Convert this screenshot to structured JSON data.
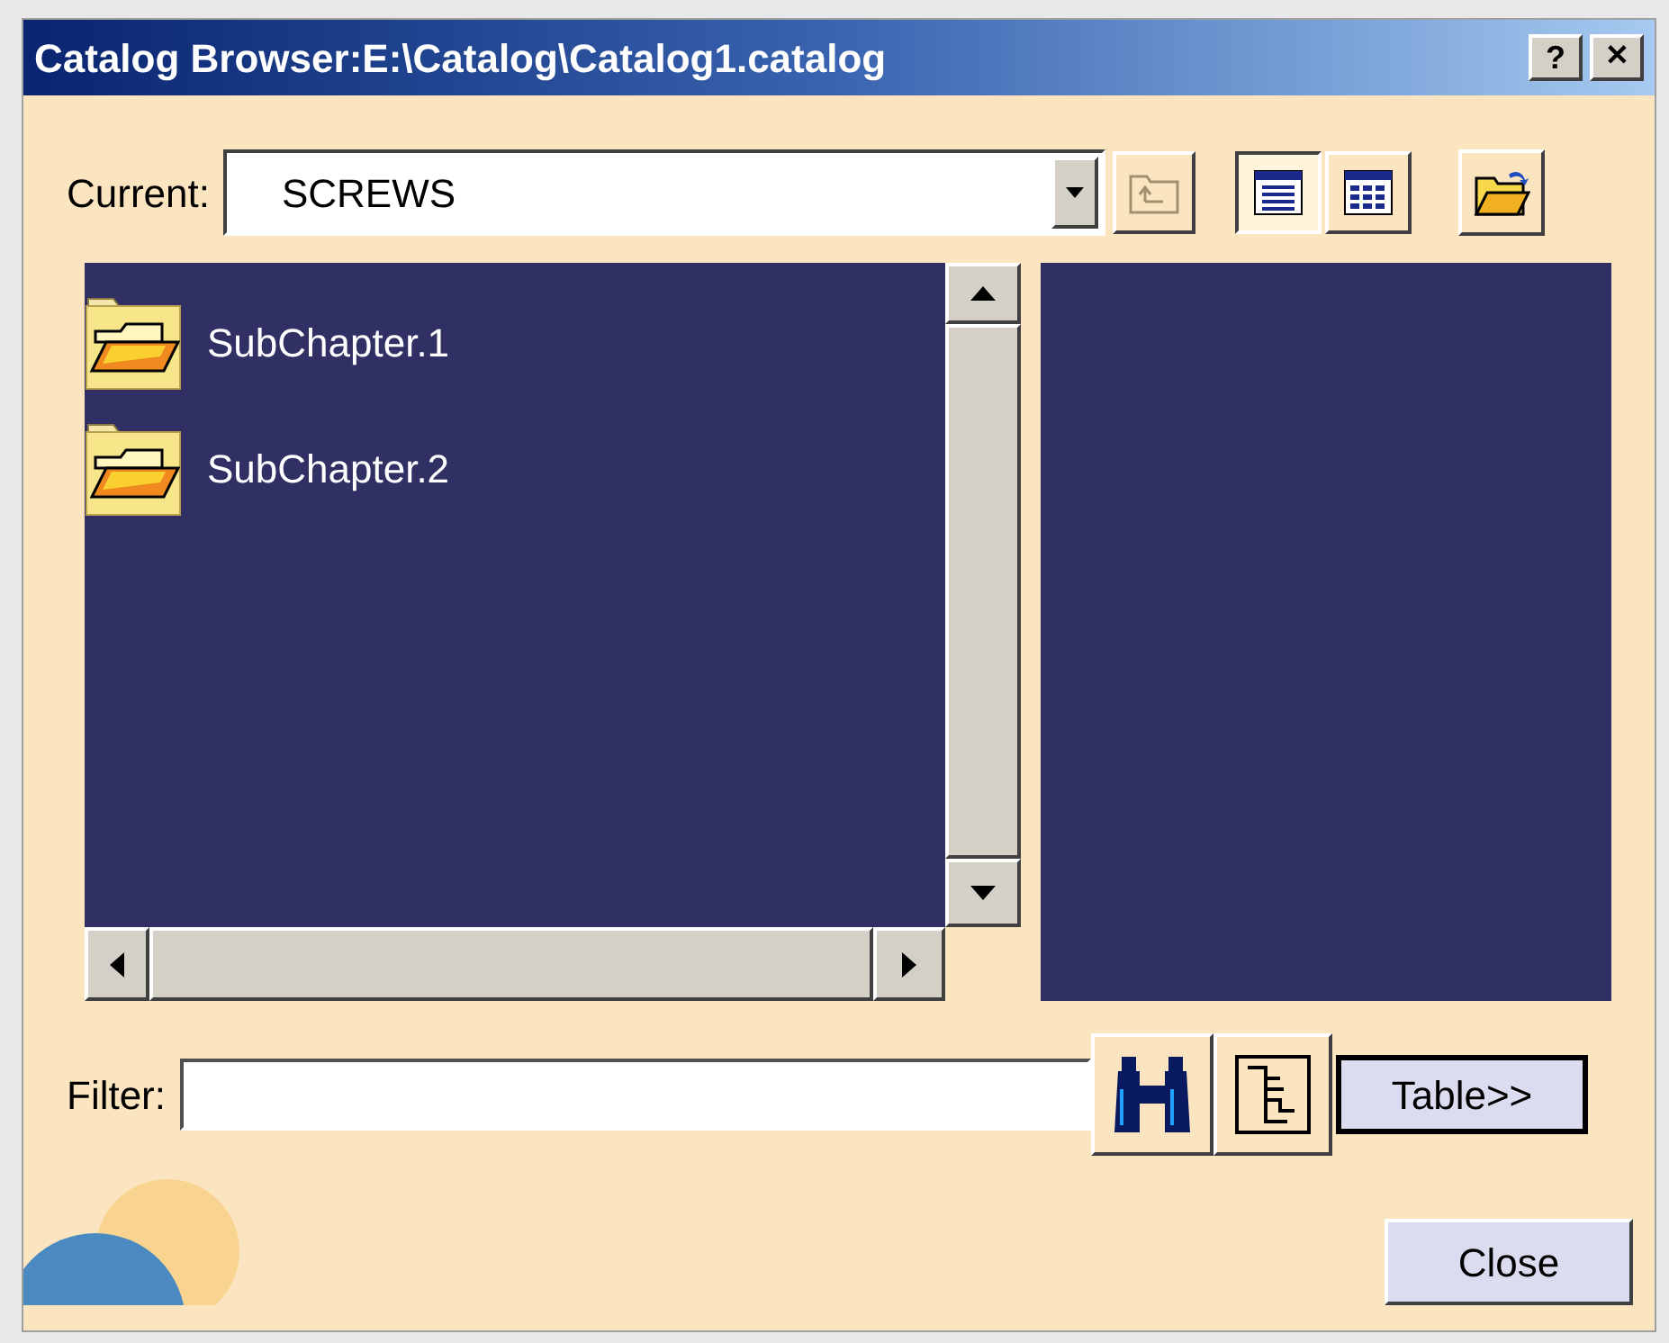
{
  "window": {
    "title": "Catalog Browser:E:\\Catalog\\Catalog1.catalog",
    "help_button": "?",
    "close_button": "✕"
  },
  "current": {
    "label": "Current:",
    "value": "SCREWS"
  },
  "view_modes": [
    {
      "kind": "list",
      "selected": true
    },
    {
      "kind": "details",
      "selected": false
    }
  ],
  "items": [
    {
      "label": "SubChapter.1"
    },
    {
      "label": "SubChapter.2"
    }
  ],
  "filter": {
    "label": "Filter:"
  },
  "table_button": "Table>>",
  "close": "Close"
}
